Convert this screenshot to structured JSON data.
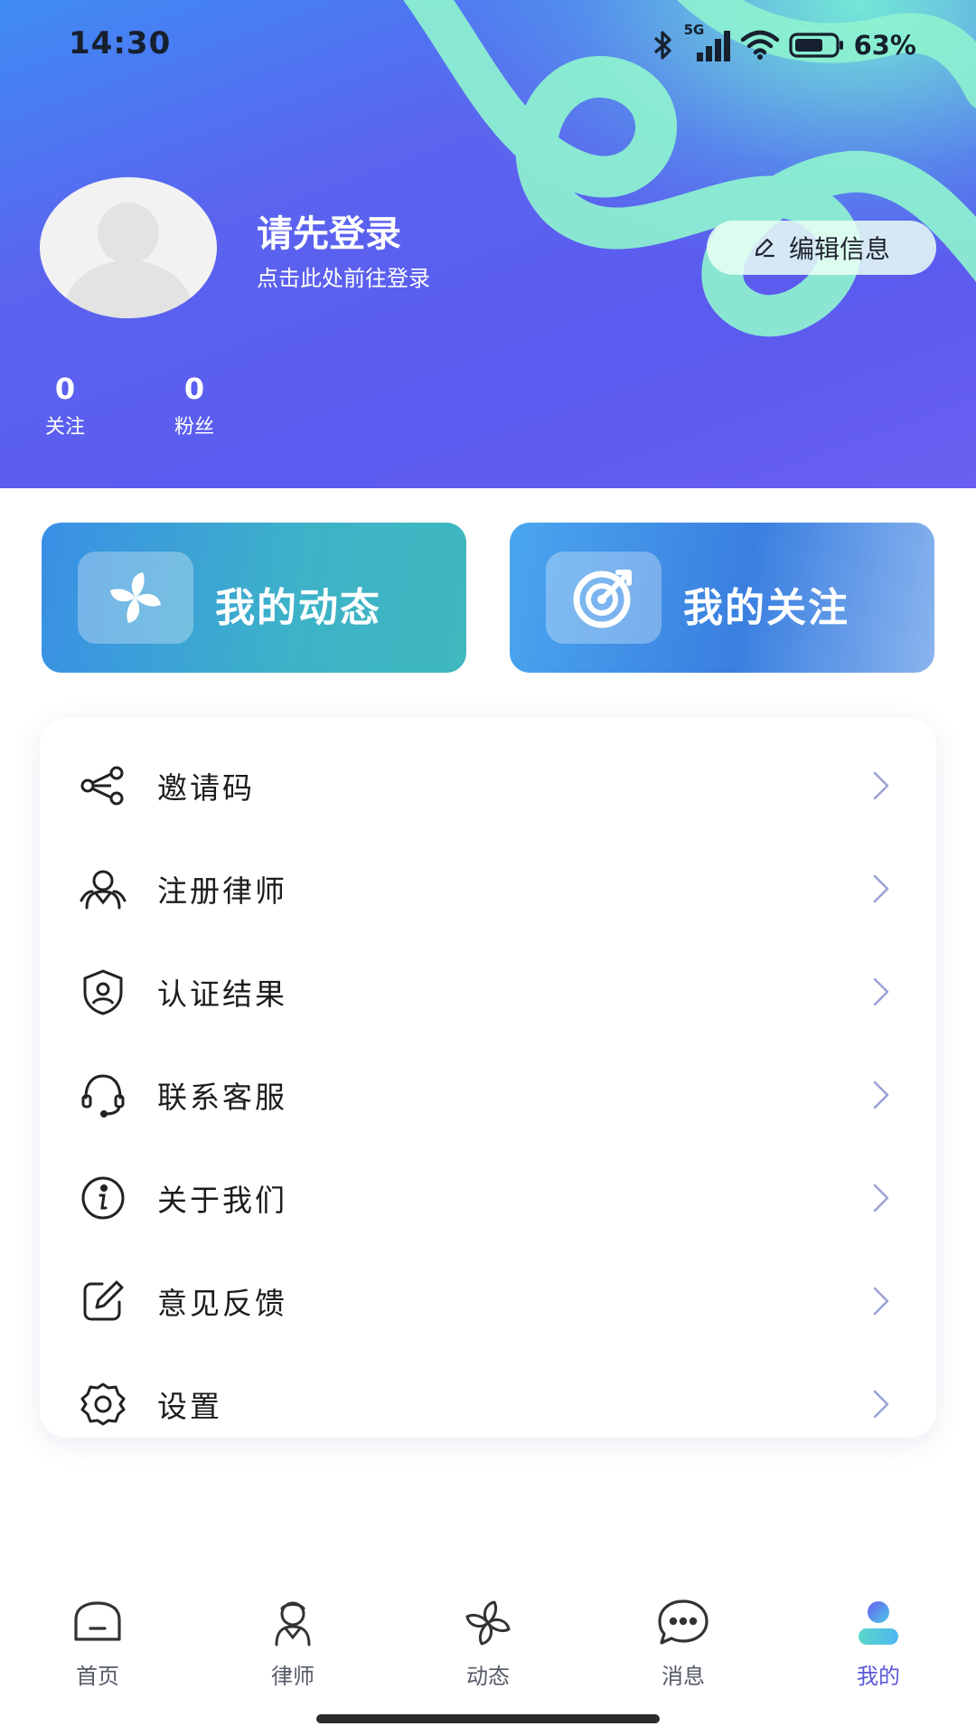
{
  "status_bar": {
    "time": "14:30",
    "network": "5G",
    "battery": "63%",
    "icons": [
      "bluetooth-icon",
      "signal-icon",
      "wifi-icon",
      "battery-icon"
    ]
  },
  "profile": {
    "title": "请先登录",
    "subtitle": "点击此处前往登录",
    "edit_label": "编辑信息",
    "stats": [
      {
        "value": "0",
        "label": "关注"
      },
      {
        "value": "0",
        "label": "粉丝"
      }
    ]
  },
  "quick_cards": [
    {
      "label": "我的动态",
      "icon": "pinwheel-icon"
    },
    {
      "label": "我的关注",
      "icon": "target-icon"
    }
  ],
  "menu": [
    {
      "label": "邀请码",
      "icon": "share-icon"
    },
    {
      "label": "注册律师",
      "icon": "lawyer-icon"
    },
    {
      "label": "认证结果",
      "icon": "shield-user-icon"
    },
    {
      "label": "联系客服",
      "icon": "headset-icon"
    },
    {
      "label": "关于我们",
      "icon": "info-icon"
    },
    {
      "label": "意见反馈",
      "icon": "edit-icon"
    },
    {
      "label": "设置",
      "icon": "gear-icon"
    }
  ],
  "tabs": [
    {
      "label": "首页",
      "icon": "home-icon",
      "active": false
    },
    {
      "label": "律师",
      "icon": "lawyer-icon",
      "active": false
    },
    {
      "label": "动态",
      "icon": "pinwheel-icon",
      "active": false
    },
    {
      "label": "消息",
      "icon": "chat-icon",
      "active": false
    },
    {
      "label": "我的",
      "icon": "user-icon",
      "active": true
    }
  ],
  "colors": {
    "header_blue": "#5b5bef",
    "accent_mint": "#78ffd2",
    "active_tab": "#5a58d8",
    "chevron": "#9aa3d6"
  }
}
